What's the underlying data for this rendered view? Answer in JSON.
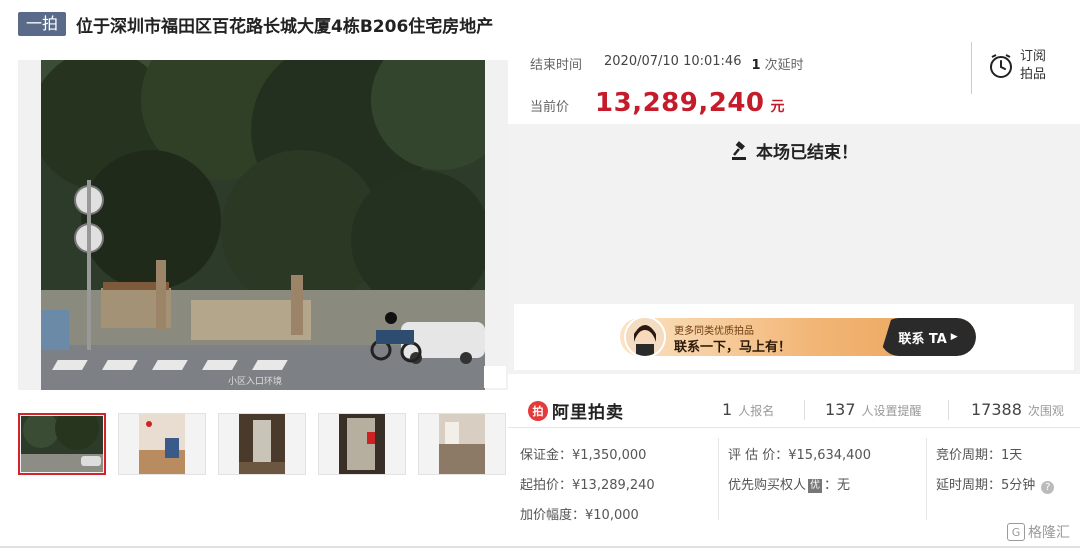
{
  "header": {
    "badge": "一拍",
    "title": "位于深圳市福田区百花路长城大厦4栋B206住宅房地产"
  },
  "photo": {
    "caption": "小区入口环境",
    "zoom_icon": "magnifier-icon"
  },
  "thumbnails": [
    {
      "name": "thumb-1",
      "active": true
    },
    {
      "name": "thumb-2",
      "active": false
    },
    {
      "name": "thumb-3",
      "active": false
    },
    {
      "name": "thumb-4",
      "active": false
    },
    {
      "name": "thumb-5",
      "active": false
    }
  ],
  "auction": {
    "end_label": "结束时间",
    "end_time": "2020/07/10 10:01:46",
    "delay_count": "1",
    "delay_label": "次延时",
    "price_label": "当前价",
    "price": "13,289,240",
    "price_unit": "元",
    "subscribe_label": "订阅拍品",
    "ended_text": "本场已结束！"
  },
  "banner": {
    "line1": "更多同类优质拍品",
    "line2": "联系一下，马上有！",
    "contact": "联系 TA"
  },
  "stats": {
    "logo_mark": "拍",
    "logo_name": "阿里拍卖",
    "registrants_num": "1",
    "registrants_label": "人报名",
    "reminders_num": "137",
    "reminders_label": "人设置提醒",
    "views_num": "17388",
    "views_label": "次围观"
  },
  "details": {
    "deposit": "保证金：¥1,350,000",
    "start_price": "起拍价：¥13,289,240",
    "increment": "加价幅度：¥10,000",
    "appraisal": "评 估 价：¥15,634,400",
    "priority_label": "优先购买权人",
    "priority_tag": "优",
    "priority_value": "：无",
    "bid_period": "竞价周期：1天",
    "delay_period": "延时周期：5分钟"
  },
  "watermark": {
    "text": "格隆汇",
    "icon_letter": "G"
  },
  "colors": {
    "price": "#c51c2b",
    "badge": "#5a6b8a",
    "active_thumb_border": "#d4232b",
    "gray_panel": "#f2f2f2"
  }
}
